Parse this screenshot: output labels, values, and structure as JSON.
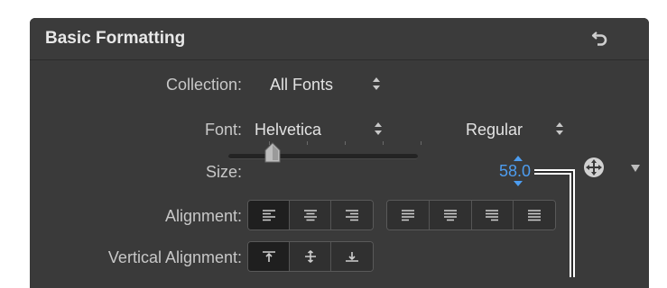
{
  "header": {
    "title": "Basic Formatting"
  },
  "collection": {
    "label": "Collection:",
    "value": "All Fonts"
  },
  "font": {
    "label": "Font:",
    "family": "Helvetica",
    "style": "Regular"
  },
  "size": {
    "label": "Size:",
    "value": "58.0",
    "slider_fraction": 0.2
  },
  "alignment": {
    "label": "Alignment:",
    "options": [
      "align-left",
      "align-center",
      "align-right",
      "justify-left",
      "justify-center",
      "justify-right",
      "justify-full"
    ],
    "selected": "align-left"
  },
  "vertical_alignment": {
    "label": "Vertical Alignment:",
    "options": [
      "align-top",
      "align-middle",
      "align-bottom"
    ],
    "selected": "align-top"
  },
  "colors": {
    "panel": "#3a3a3a",
    "accent": "#4d9df0",
    "text": "#c8c8c8"
  }
}
